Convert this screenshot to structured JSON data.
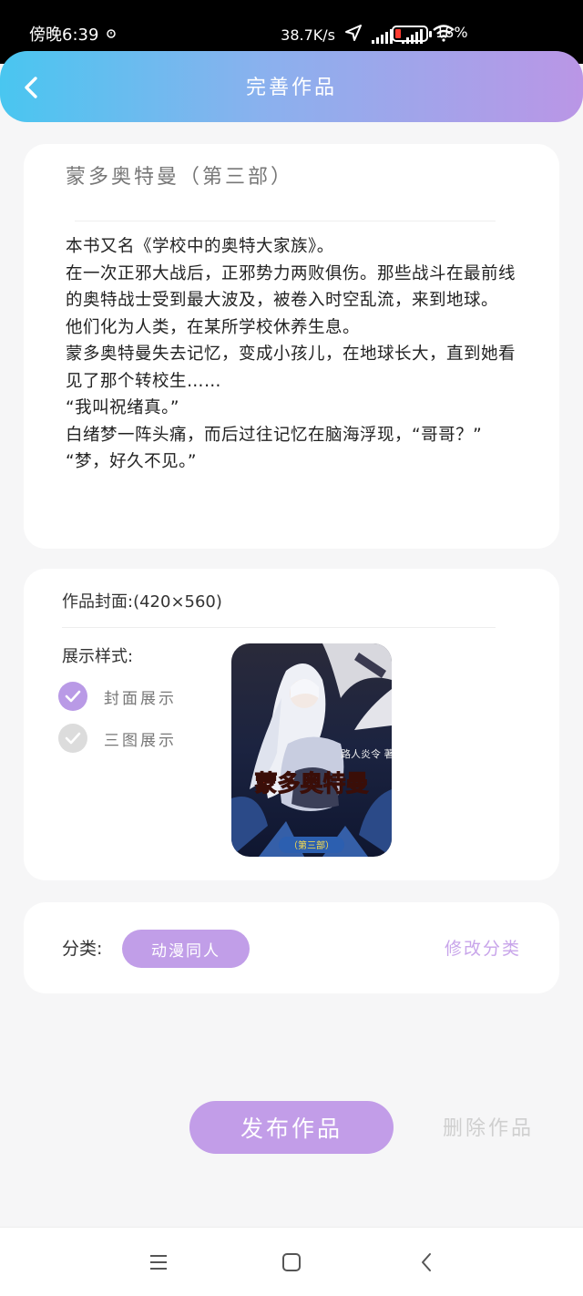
{
  "status_bar": {
    "time": "傍晚6:39",
    "net_speed": "38.7K/s",
    "battery": "18%",
    "battery_level": 0.18,
    "icons": [
      "alarm-icon",
      "location-icon",
      "signal-hd-icon",
      "signal-hd-icon",
      "wifi-icon",
      "battery-icon"
    ]
  },
  "header": {
    "title": "完善作品",
    "back_icon": "chevron-left-icon",
    "gradient": [
      "#49c6f0",
      "#ba96e6"
    ]
  },
  "book": {
    "title": "蒙多奥特曼（第三部）",
    "description": [
      "本书又名《学校中的奥特大家族》。",
      "在一次正邪大战后，正邪势力两败俱伤。那些战斗在最前线的奥特战士受到最大波及，被卷入时空乱流，来到地球。",
      "他们化为人类，在某所学校休养生息。",
      "蒙多奥特曼失去记忆，变成小孩儿，在地球长大，直到她看见了那个转校生……",
      "“我叫祝绪真。”",
      "白绪梦一阵头痛，而后过往记忆在脑海浮现，“哥哥？”",
      "“梦，好久不见。”"
    ]
  },
  "cover": {
    "label": "作品封面:(420×560)",
    "style_label": "展示样式:",
    "options": [
      {
        "label": "封面展示",
        "selected": true
      },
      {
        "label": "三图展示",
        "selected": false
      }
    ],
    "image_text": {
      "title": "蒙多奥特曼",
      "part": "（第三部）",
      "author": "路人炎令 著"
    }
  },
  "category": {
    "label": "分类:",
    "value": "动漫同人",
    "edit_label": "修改分类"
  },
  "actions": {
    "publish": "发布作品",
    "delete": "删除作品"
  },
  "colors": {
    "accent": "#c29de8",
    "muted": "#cfcfcf",
    "edit": "#c8a5ea"
  },
  "navbar": {
    "icons": [
      "menu-icon",
      "home-square-icon",
      "back-triangle-icon"
    ]
  }
}
